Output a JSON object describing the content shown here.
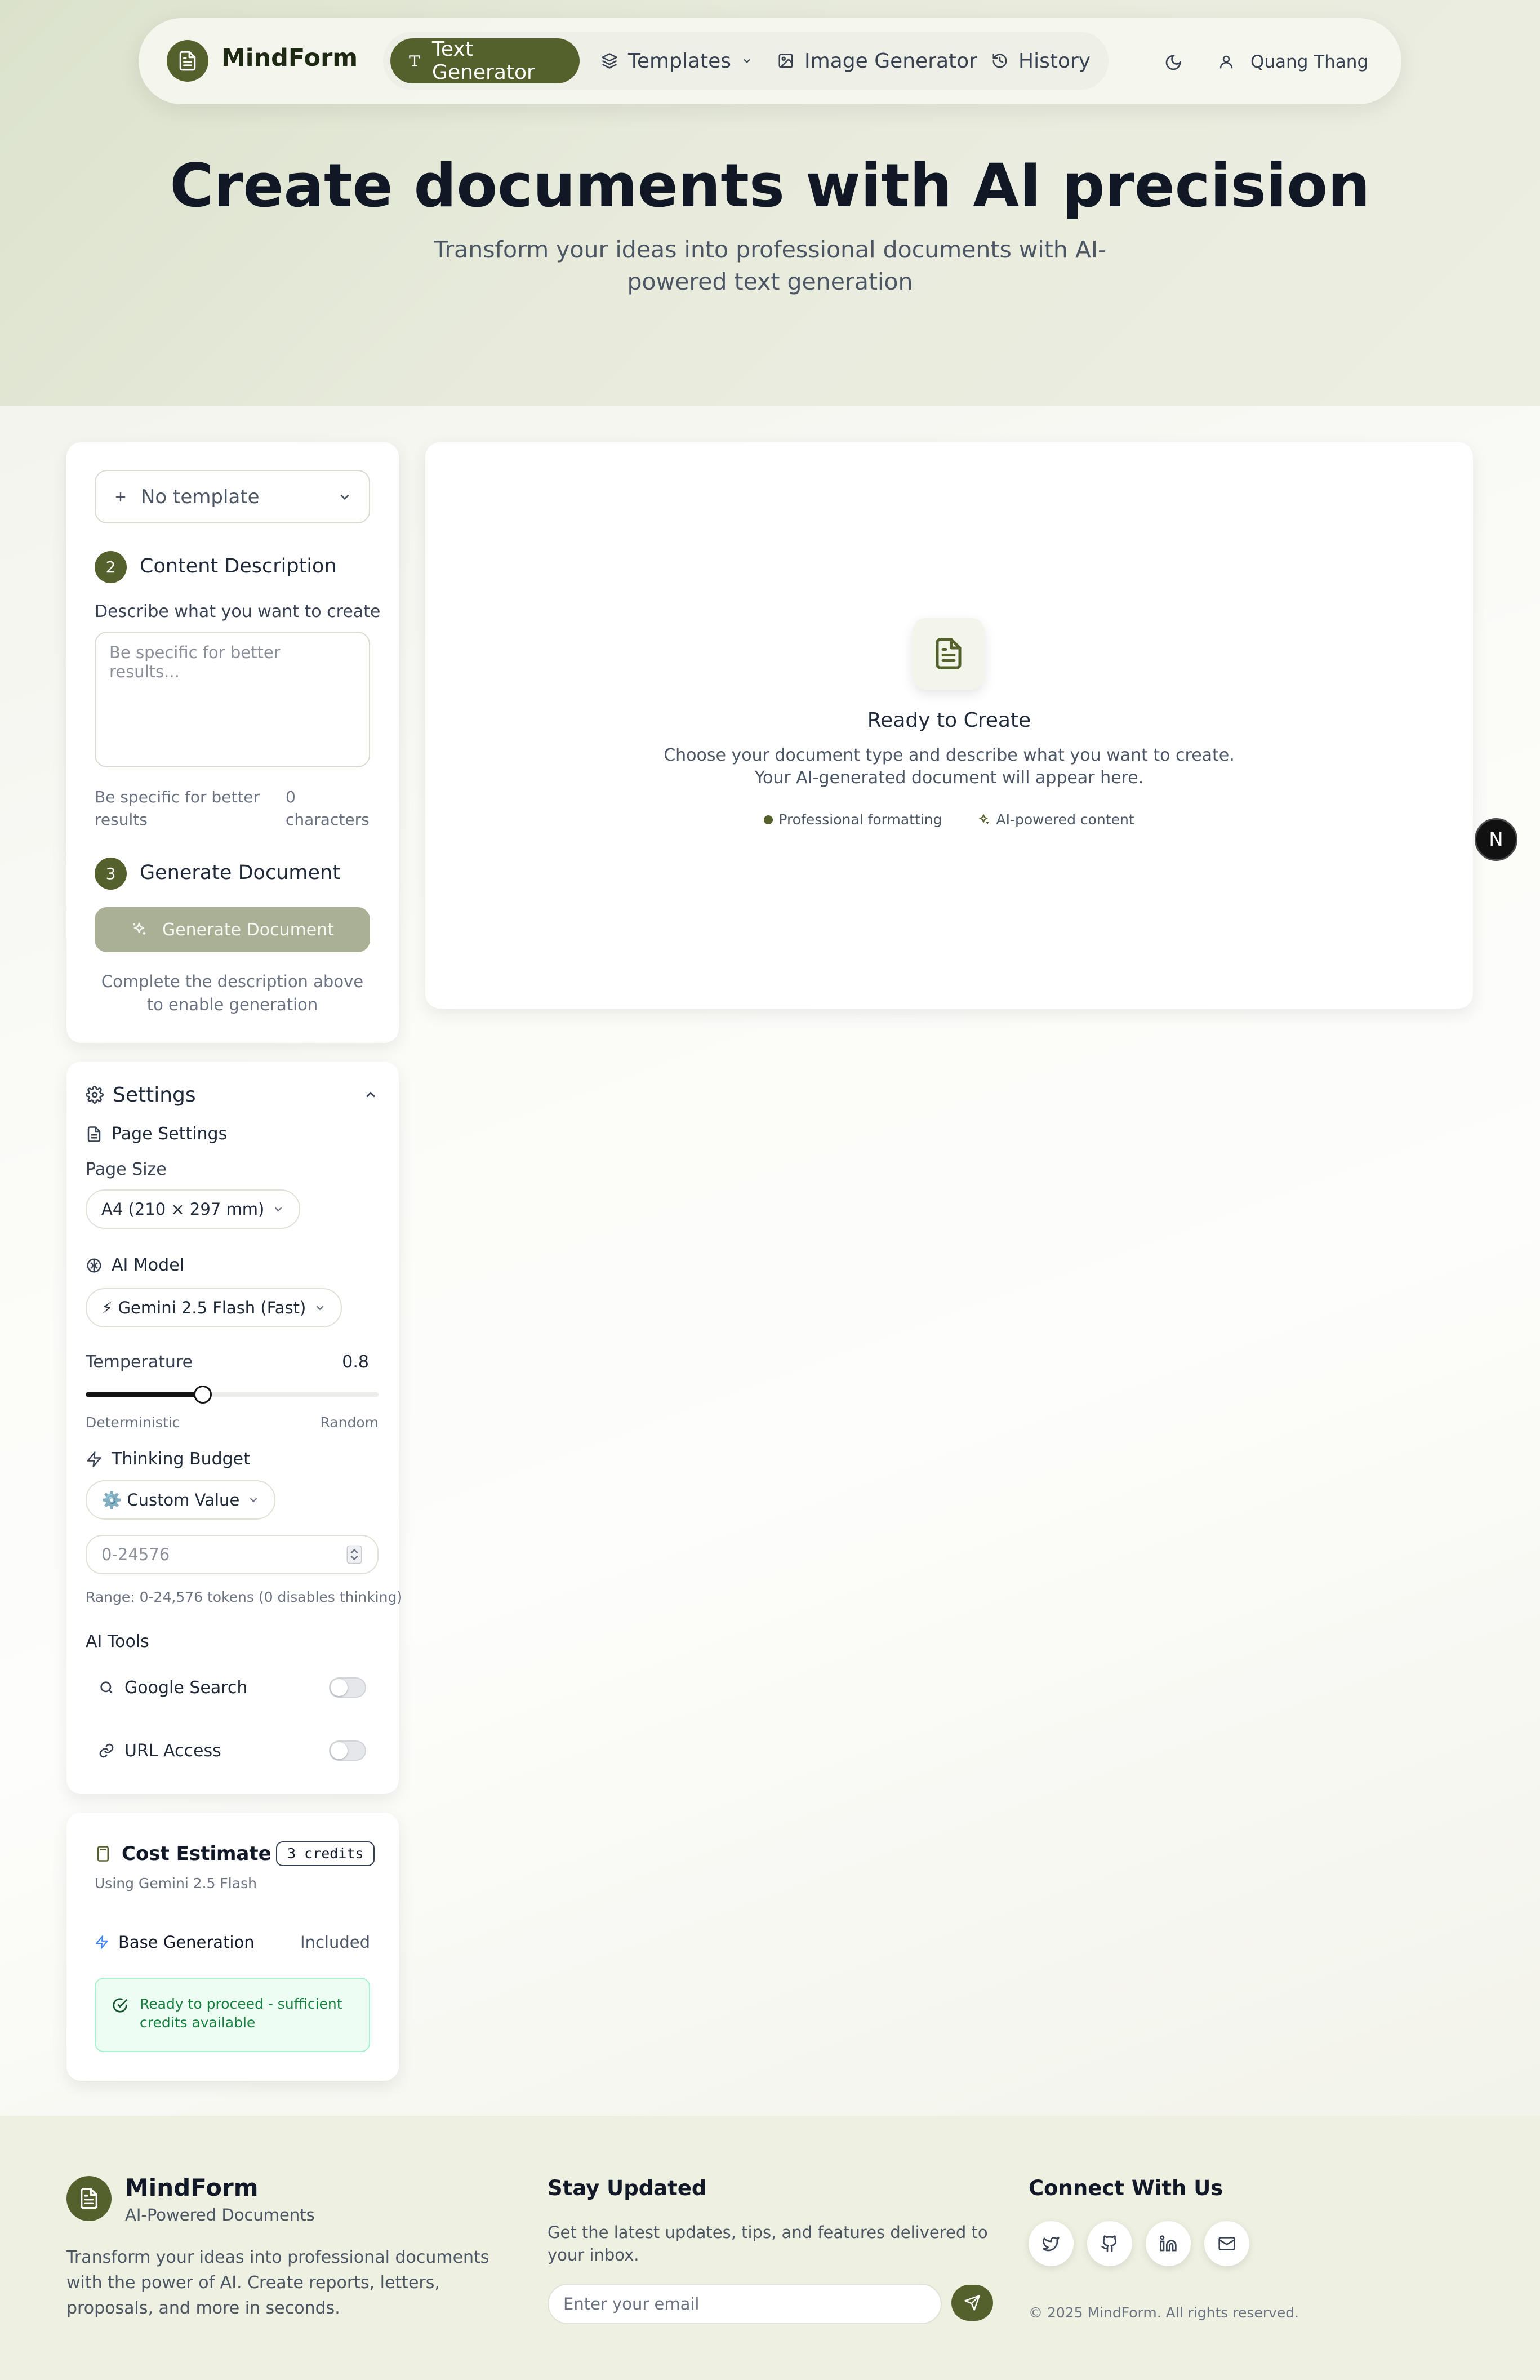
{
  "nav": {
    "brand": "MindForm",
    "items": [
      {
        "label": "Text Generator",
        "icon": "type-icon"
      },
      {
        "label": "Templates",
        "icon": "layers-icon"
      },
      {
        "label": "Image Generator",
        "icon": "image-icon"
      },
      {
        "label": "History",
        "icon": "history-icon"
      }
    ],
    "user": "Quang Thang",
    "accent": "#55612c"
  },
  "hero": {
    "title": "Create documents with AI precision",
    "subtitle": "Transform your ideas into professional documents with AI-powered text generation"
  },
  "composer": {
    "template_select": "No template",
    "step2": {
      "number": "2",
      "title": "Content Description"
    },
    "describe_label": "Describe what you want to create",
    "textarea_placeholder": "Be specific for better results...",
    "hint": "Be specific for better results",
    "char_count": "0",
    "char_label": "characters",
    "step3": {
      "number": "3",
      "title": "Generate Document"
    },
    "generate_button": "Generate Document",
    "generate_note": "Complete the description above to enable generation"
  },
  "settings": {
    "title": "Settings",
    "page_settings": "Page Settings",
    "page_size_label": "Page Size",
    "page_size_value": "A4 (210 × 297 mm)",
    "ai_model_label": "AI Model",
    "ai_model_value": "⚡ Gemini 2.5 Flash (Fast)",
    "temperature_label": "Temperature",
    "temperature_value": "0.8",
    "temperature_fraction": 0.4,
    "temp_min": "Deterministic",
    "temp_max": "Random",
    "thinking_label": "Thinking Budget",
    "thinking_value": "⚙️ Custom Value",
    "thinking_placeholder": "0-24576",
    "range_note": "Range: 0-24,576 tokens (0 disables thinking)",
    "tools_label": "AI Tools",
    "tools": [
      {
        "label": "Google Search",
        "enabled": false
      },
      {
        "label": "URL Access",
        "enabled": false
      }
    ]
  },
  "cost": {
    "title": "Cost Estimate",
    "badge": "3 credits",
    "subtitle": "Using Gemini 2.5 Flash",
    "line_label": "Base Generation",
    "line_value": "Included",
    "status": "Ready to proceed - sufficient credits available",
    "status_color": "#15803d"
  },
  "preview": {
    "title": "Ready to Create",
    "line1": "Choose your document type and describe what you want to create.",
    "line2": "Your AI-generated document will appear here.",
    "feature1": "Professional formatting",
    "feature2": "AI-powered content"
  },
  "floating_button": "N",
  "footer": {
    "brand": "MindForm",
    "tagline": "AI-Powered Documents",
    "description": "Transform your ideas into professional documents with the power of AI. Create reports, letters, proposals, and more in seconds.",
    "stay_title": "Stay Updated",
    "stay_text": "Get the latest updates, tips, and features delivered to your inbox.",
    "email_placeholder": "Enter your email",
    "connect_title": "Connect With Us",
    "copyright": "© 2025 MindForm. All rights reserved."
  }
}
